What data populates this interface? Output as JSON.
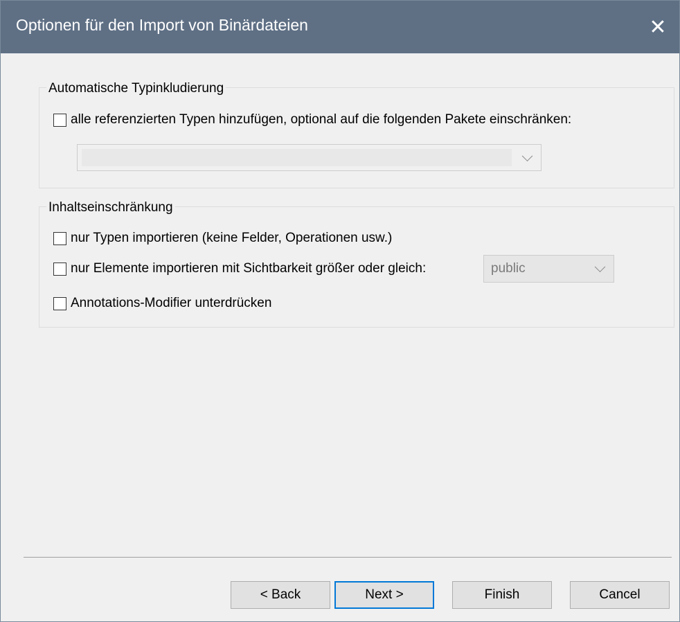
{
  "window": {
    "title": "Optionen für den Import von Binärdateien",
    "close_icon": "close-icon"
  },
  "auto_type": {
    "group_label": "Automatische Typinkludierung",
    "add_all_label": "alle referenzierten Typen hinzufügen, optional auf die folgenden Pakete einschränken:",
    "add_all_checked": false,
    "packages_value": ""
  },
  "content": {
    "group_label": "Inhaltseinschränkung",
    "types_only_label": "nur Typen importieren (keine Felder, Operationen usw.)",
    "types_only_checked": false,
    "visibility_label": "nur Elemente importieren mit Sichtbarkeit größer oder gleich:",
    "visibility_checked": false,
    "visibility_value": "public",
    "suppress_label": "Annotations-Modifier unterdrücken",
    "suppress_checked": false
  },
  "buttons": {
    "back": "< Back",
    "next": "Next >",
    "finish": "Finish",
    "cancel": "Cancel"
  }
}
